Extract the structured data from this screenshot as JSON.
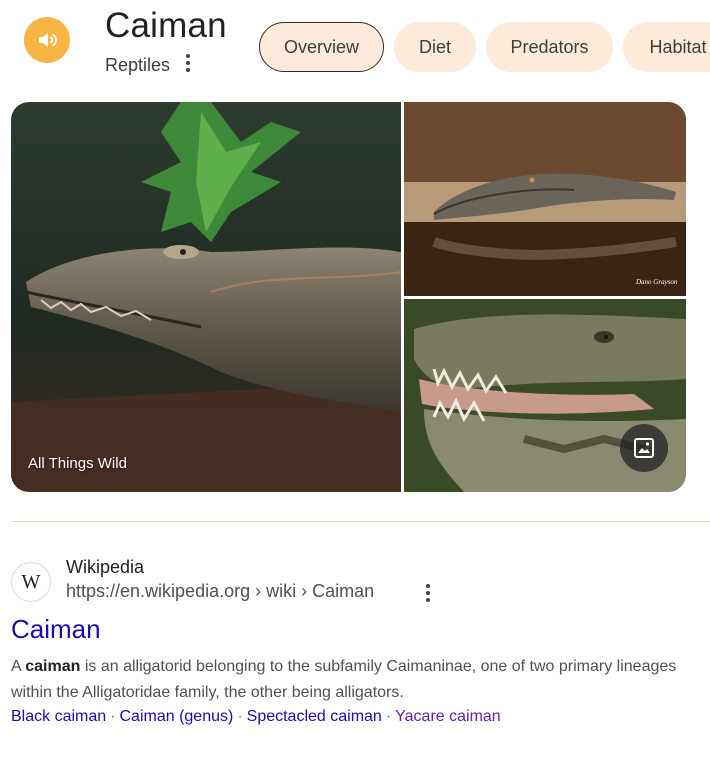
{
  "header": {
    "title": "Caiman",
    "subtitle": "Reptiles"
  },
  "tabs": [
    {
      "label": "Overview",
      "active": true
    },
    {
      "label": "Diet",
      "active": false
    },
    {
      "label": "Predators",
      "active": false
    },
    {
      "label": "Habitat",
      "active": false
    }
  ],
  "images": {
    "main_source": "All Things Wild",
    "top_right_watermark": "Dano Grayson"
  },
  "result": {
    "favicon_letter": "W",
    "site_name": "Wikipedia",
    "url": "https://en.wikipedia.org › wiki › Caiman",
    "title": "Caiman",
    "snippet_pre": "A ",
    "snippet_bold": "caiman",
    "snippet_post": " is an alligatorid belonging to the subfamily Caimaninae, one of two primary lineages within the Alligatoridae family, the other being alligators.",
    "links": [
      {
        "label": "Black caiman",
        "visited": false
      },
      {
        "label": "Caiman (genus)",
        "visited": false
      },
      {
        "label": "Spectacled caiman",
        "visited": false
      },
      {
        "label": "Yacare caiman",
        "visited": true
      }
    ]
  },
  "colors": {
    "accent": "#f6b545",
    "tab_bg": "#fcebd9",
    "link": "#1a0dab",
    "visited_link": "#681da8"
  },
  "icons": [
    "speaker-icon",
    "more-vert-icon",
    "image-search-icon",
    "wikipedia-favicon"
  ]
}
